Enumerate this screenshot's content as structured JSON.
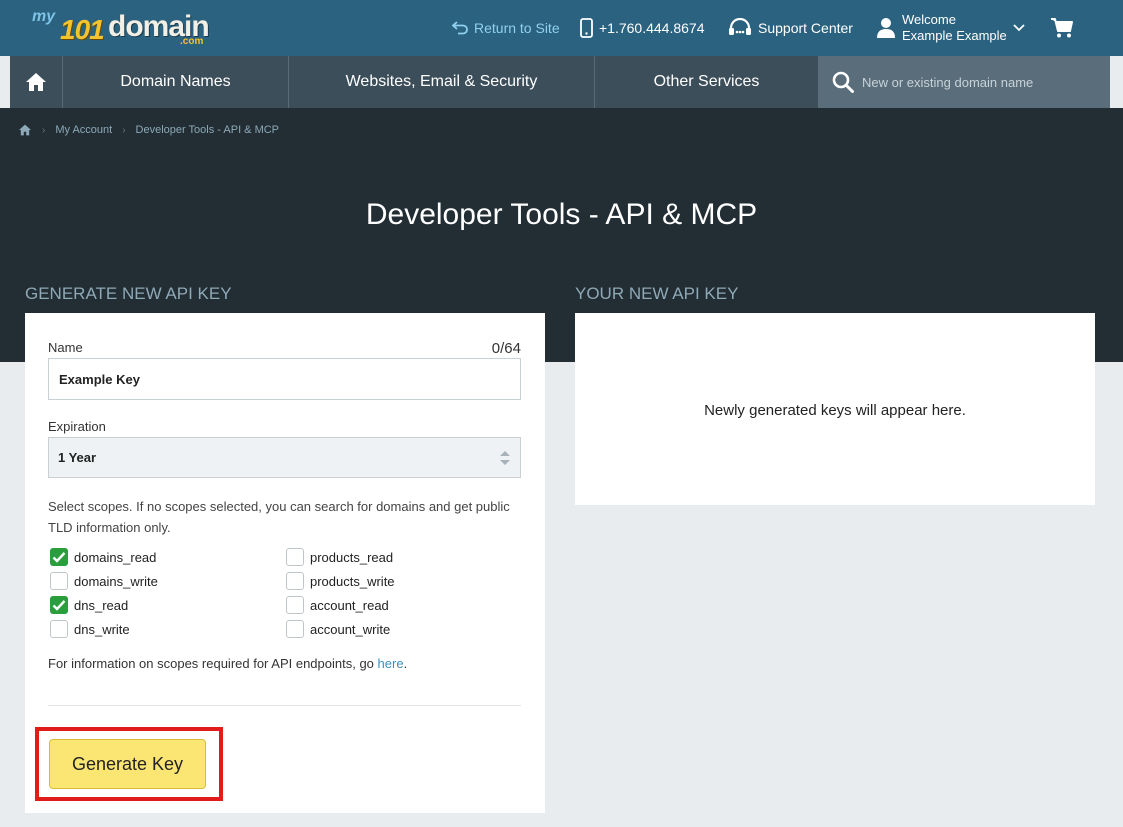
{
  "brand": {
    "logo_my": "my",
    "logo_num": "101",
    "logo_domain": "domain",
    "logo_com": ".com"
  },
  "topbar": {
    "return_label": "Return to Site",
    "phone": "+1.760.444.8674",
    "support_label": "Support Center",
    "welcome_line1": "Welcome",
    "welcome_line2": "Example Example"
  },
  "nav": {
    "items": [
      "Domain Names",
      "Websites, Email & Security",
      "Other Services"
    ],
    "search_placeholder": "New or existing domain name"
  },
  "breadcrumb": [
    "My Account",
    "Developer Tools - API & MCP"
  ],
  "page_title": "Developer Tools - API & MCP",
  "generate": {
    "heading": "GENERATE NEW API KEY",
    "name_label": "Name",
    "name_counter": "0/64",
    "name_value": "Example Key",
    "expiration_label": "Expiration",
    "expiration_value": "1 Year",
    "scopes_text": "Select scopes. If no scopes selected, you can search for domains and get public TLD information only.",
    "scopes": [
      {
        "label": "domains_read",
        "checked": true
      },
      {
        "label": "domains_write",
        "checked": false
      },
      {
        "label": "dns_read",
        "checked": true
      },
      {
        "label": "dns_write",
        "checked": false
      },
      {
        "label": "products_read",
        "checked": false
      },
      {
        "label": "products_write",
        "checked": false
      },
      {
        "label": "account_read",
        "checked": false
      },
      {
        "label": "account_write",
        "checked": false
      }
    ],
    "info_prefix": "For information on scopes required for API endpoints, go ",
    "info_link": "here",
    "info_suffix": ".",
    "button_label": "Generate Key"
  },
  "new_key": {
    "heading": "YOUR NEW API KEY",
    "empty_message": "Newly generated keys will appear here."
  },
  "colors": {
    "topbar": "#2a627f",
    "nav": "#3c4e5a",
    "hero": "#222d34",
    "button": "#fce673",
    "check": "#2a9d3c",
    "highlight": "#e21b1b"
  }
}
